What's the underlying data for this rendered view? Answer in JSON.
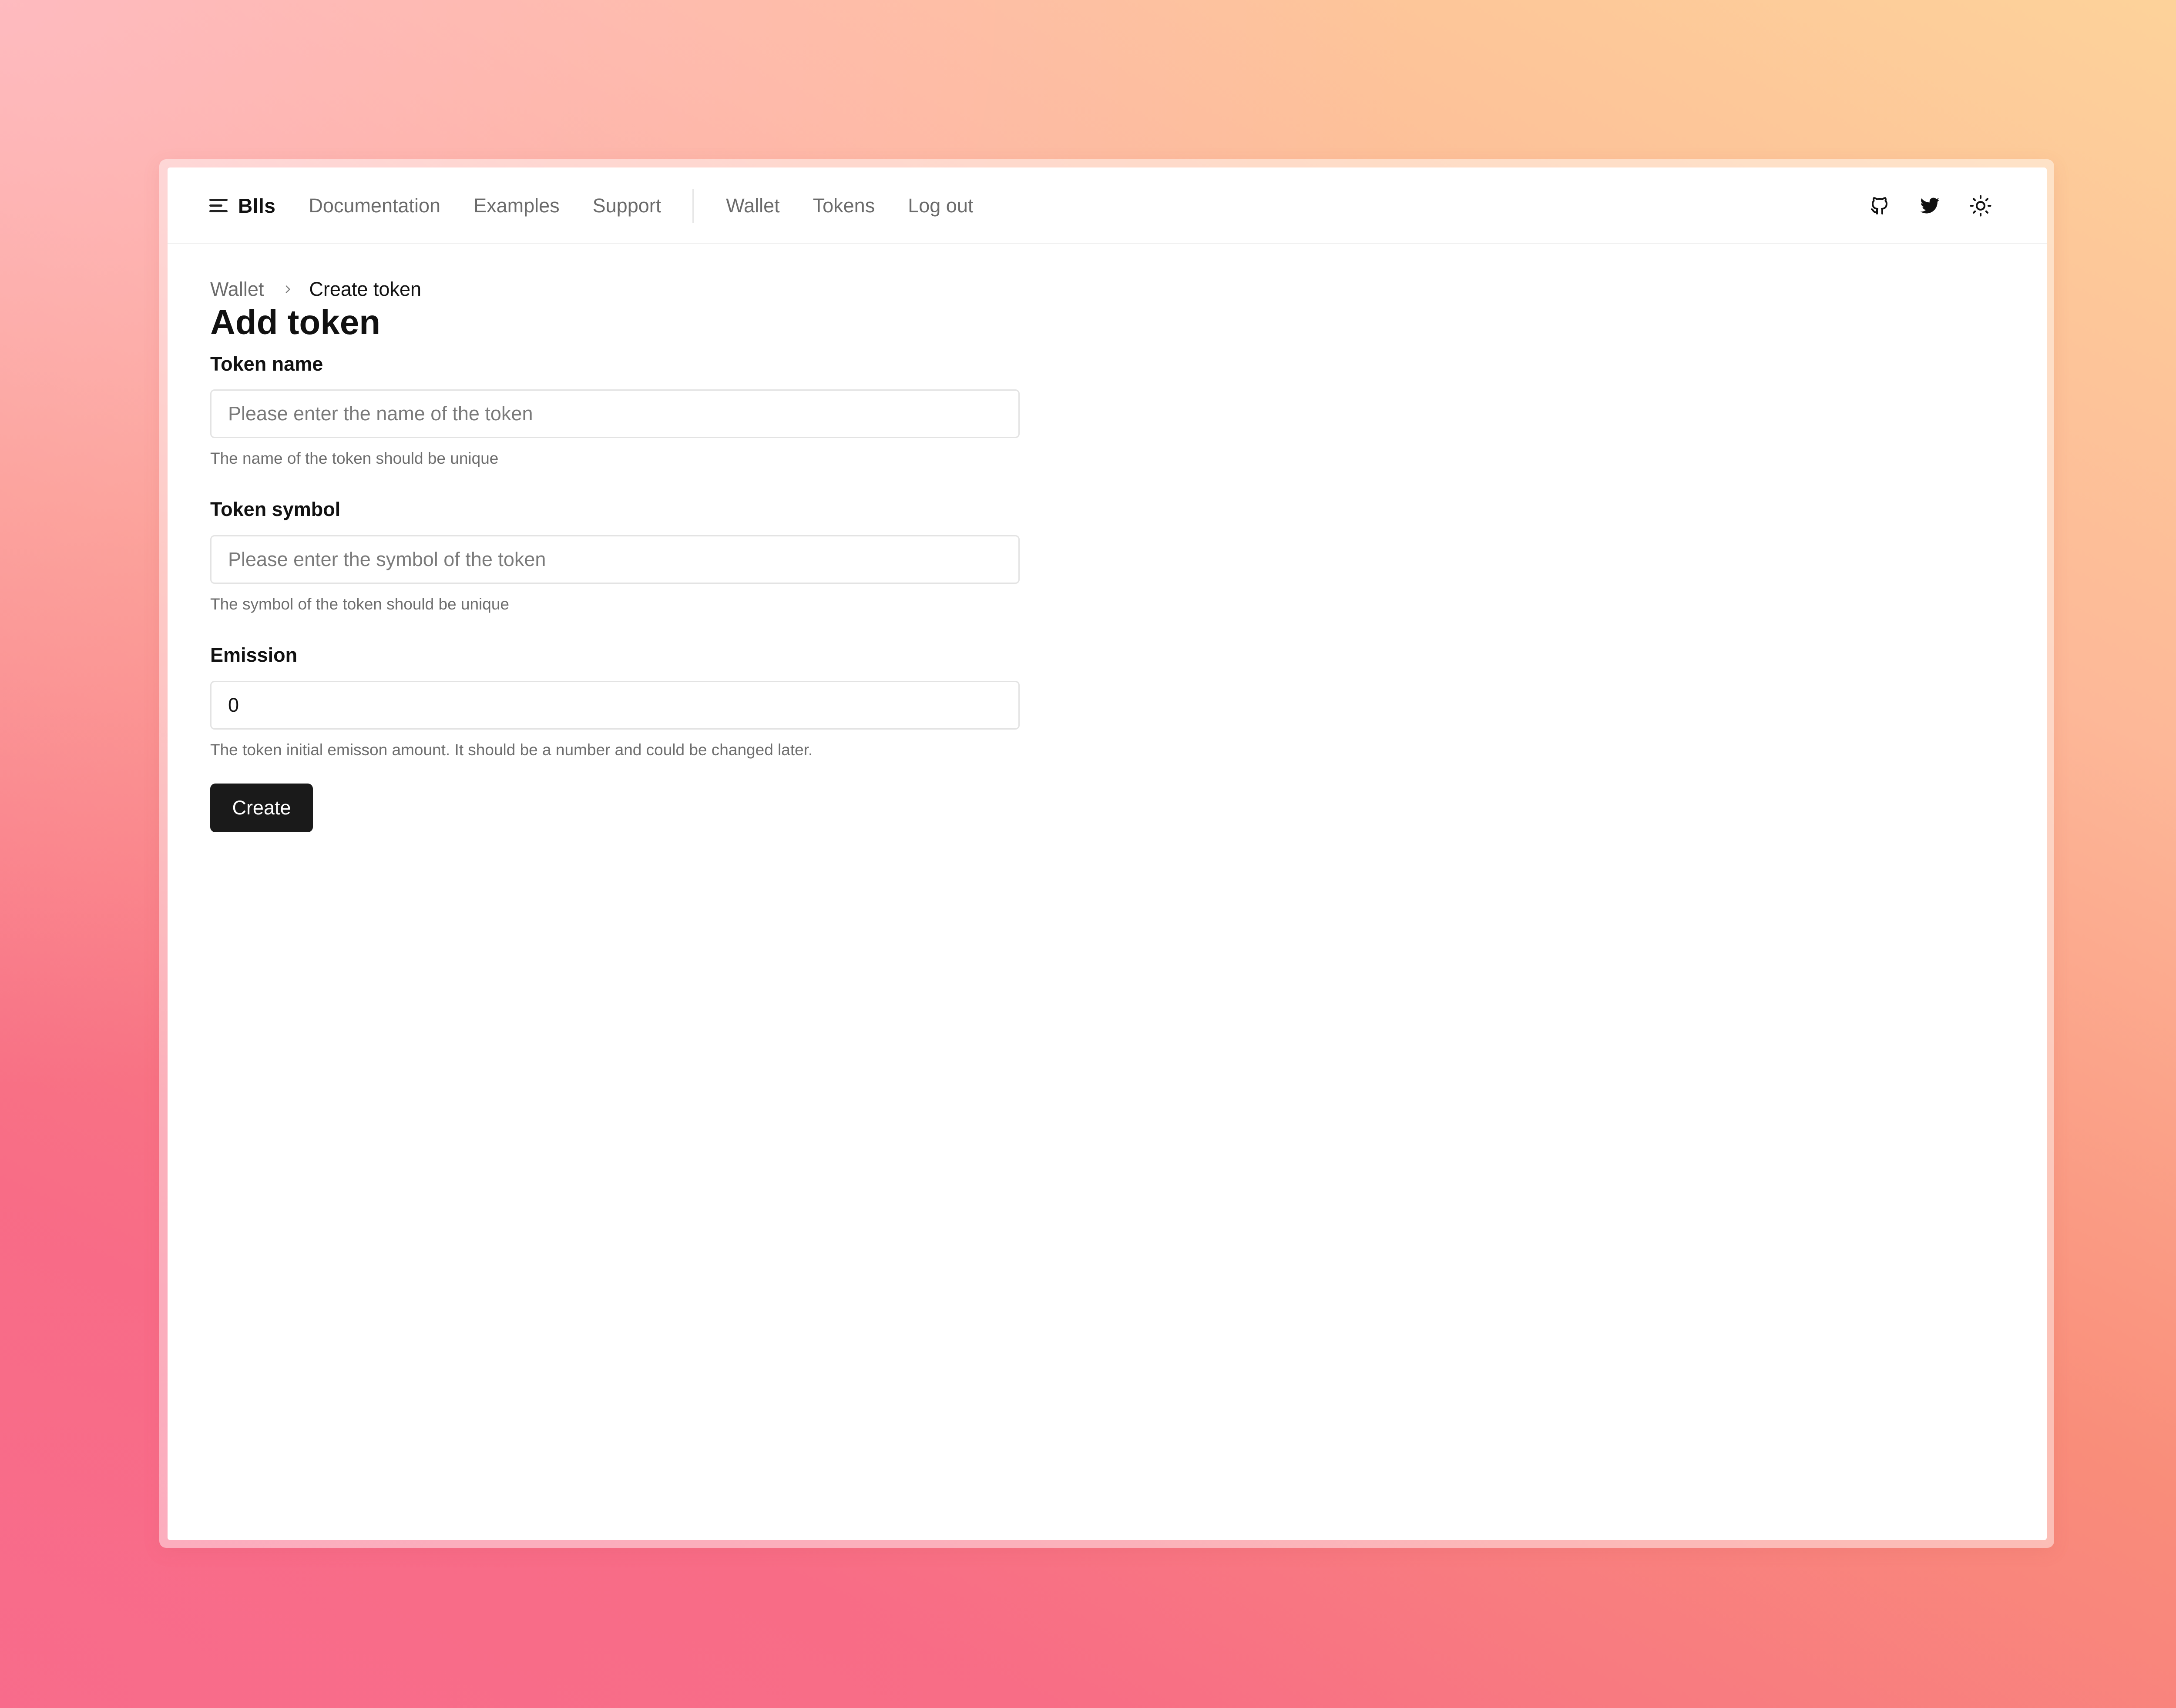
{
  "header": {
    "brand": "Blls",
    "nav_links": [
      "Documentation",
      "Examples",
      "Support"
    ],
    "account_links": [
      "Wallet",
      "Tokens",
      "Log out"
    ],
    "icons": [
      "menu-icon",
      "github-icon",
      "twitter-icon",
      "sun-icon"
    ]
  },
  "breadcrumb": {
    "parent": "Wallet",
    "current": "Create token"
  },
  "page": {
    "title": "Add token"
  },
  "form": {
    "token_name": {
      "label": "Token name",
      "value": "",
      "placeholder": "Please enter the name of the token",
      "help": "The name of the token should be unique"
    },
    "token_symbol": {
      "label": "Token symbol",
      "value": "",
      "placeholder": "Please enter the symbol of the token",
      "help": "The symbol of the token should be unique"
    },
    "emission": {
      "label": "Emission",
      "value": "0",
      "placeholder": "",
      "help": "The token initial emisson amount. It should be a number and could be changed later."
    },
    "submit_label": "Create"
  },
  "colors": {
    "primary_button": "#1a1a1a",
    "text": "#111111",
    "muted_text": "#6b6b6b",
    "border": "#e3e3e3"
  }
}
